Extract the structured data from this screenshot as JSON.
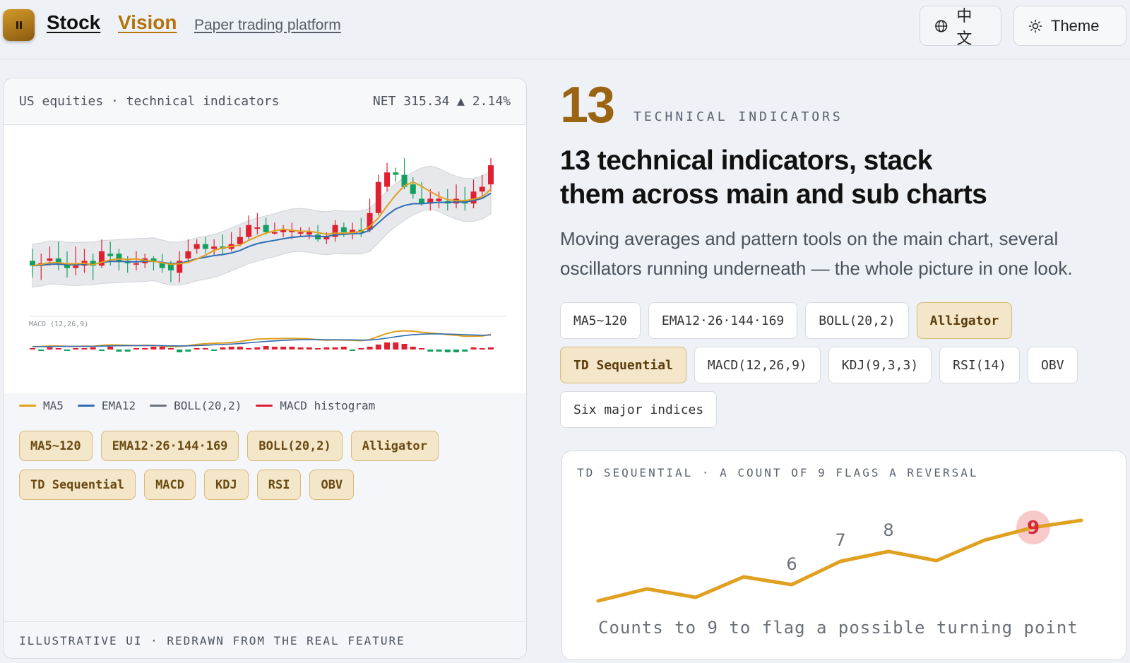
{
  "header": {
    "brand_part1": "Stock",
    "brand_part2": "Vision",
    "subtitle": "Paper trading platform",
    "lang_label": "中文",
    "theme_label": "Theme",
    "accent_color": "#b5730f"
  },
  "left_card": {
    "market_label": "US equities · technical indicators",
    "net_label": "NET 315.34 ▲ 2.14%",
    "macd_label": "MACD (12,26,9)",
    "legend": [
      {
        "label": "MA5",
        "color": "#e0a020"
      },
      {
        "label": "EMA12",
        "color": "#2f6db3"
      },
      {
        "label": "BOLL(20,2)",
        "color": "#6b7480"
      },
      {
        "label": "MACD histogram",
        "color": "#e02030"
      }
    ],
    "tags": [
      "MA5~120",
      "EMA12·26·144·169",
      "BOLL(20,2)",
      "Alligator",
      "TD Sequential",
      "MACD",
      "KDJ",
      "RSI",
      "OBV"
    ],
    "footer": "ILLUSTRATIVE UI · REDRAWN FROM THE REAL FEATURE"
  },
  "right": {
    "big_number": "13",
    "big_label": "TECHNICAL INDICATORS",
    "headline_line1": "13 technical indicators, stack",
    "headline_line2": "them across main and sub charts",
    "desc_line1": "Moving averages and pattern tools on the main chart, several",
    "desc_line2": "oscillators running underneath — the whole picture in one look.",
    "chips": [
      {
        "label": "MA5~120",
        "active": false
      },
      {
        "label": "EMA12·26·144·169",
        "active": false
      },
      {
        "label": "BOLL(20,2)",
        "active": false
      },
      {
        "label": "Alligator",
        "active": true
      },
      {
        "label": "TD Sequential",
        "active": true
      },
      {
        "label": "MACD(12,26,9)",
        "active": false
      },
      {
        "label": "KDJ(9,3,3)",
        "active": false
      },
      {
        "label": "RSI(14)",
        "active": false
      },
      {
        "label": "OBV",
        "active": false
      },
      {
        "label": "Six major indices",
        "active": false
      }
    ]
  },
  "td_card": {
    "title": "TD SEQUENTIAL · A COUNT OF 9 FLAGS A REVERSAL",
    "caption": "Counts to 9 to flag a possible turning point",
    "counts": [
      "6",
      "7",
      "8",
      "9"
    ],
    "line_color": "#e0a020",
    "highlight_color": "#f7c9c9"
  },
  "candle_chart": {
    "up_color": "#e02030",
    "down_color": "#13a060",
    "candles": [
      [
        52,
        50,
        45,
        57
      ],
      [
        50,
        51,
        44,
        55
      ],
      [
        52,
        53,
        50,
        58
      ],
      [
        53,
        51,
        48,
        60
      ],
      [
        51,
        49,
        45,
        56
      ],
      [
        49,
        50,
        46,
        58
      ],
      [
        50,
        52,
        47,
        57
      ],
      [
        52,
        50,
        44,
        55
      ],
      [
        50,
        56,
        49,
        61
      ],
      [
        55,
        54,
        50,
        60
      ],
      [
        55,
        52,
        48,
        57
      ],
      [
        52,
        51,
        47,
        54
      ],
      [
        51,
        51,
        48,
        56
      ],
      [
        51,
        53,
        49,
        55
      ],
      [
        53,
        52,
        48,
        54
      ],
      [
        51,
        49,
        47,
        55
      ],
      [
        51,
        48,
        43,
        52
      ],
      [
        47,
        52,
        43,
        56
      ],
      [
        53,
        56,
        52,
        61
      ],
      [
        57,
        59,
        55,
        61
      ],
      [
        59,
        57,
        55,
        62
      ],
      [
        57,
        58,
        54,
        61
      ],
      [
        58,
        57,
        55,
        63
      ],
      [
        57,
        59,
        56,
        64
      ],
      [
        59,
        62,
        58,
        66
      ],
      [
        62,
        67,
        61,
        71
      ],
      [
        66,
        66,
        63,
        72
      ],
      [
        67,
        64,
        63,
        70
      ],
      [
        64,
        64,
        63,
        68
      ],
      [
        64,
        65,
        62,
        67
      ],
      [
        64,
        65,
        61,
        68
      ],
      [
        64,
        64,
        62,
        66
      ],
      [
        63,
        64,
        61,
        66
      ],
      [
        63,
        61,
        60,
        67
      ],
      [
        61,
        62,
        59,
        64
      ],
      [
        62,
        67,
        60,
        69
      ],
      [
        66,
        64,
        62,
        68
      ],
      [
        64,
        65,
        61,
        68
      ],
      [
        65,
        64,
        62,
        70
      ],
      [
        65,
        72,
        64,
        78
      ],
      [
        72,
        85,
        71,
        88
      ],
      [
        83,
        89,
        81,
        93
      ],
      [
        89,
        88,
        85,
        91
      ],
      [
        88,
        83,
        82,
        95
      ],
      [
        84,
        80,
        78,
        87
      ],
      [
        78,
        76,
        75,
        85
      ],
      [
        76,
        78,
        73,
        82
      ],
      [
        77,
        78,
        74,
        81
      ],
      [
        77,
        76,
        73,
        82
      ],
      [
        76,
        78,
        74,
        84
      ],
      [
        77,
        76,
        73,
        83
      ],
      [
        76,
        81,
        74,
        86
      ],
      [
        81,
        83,
        79,
        88
      ],
      [
        84,
        92,
        81,
        95
      ]
    ],
    "macd_hist": [
      0.2,
      -0.1,
      0.3,
      0.2,
      -0.2,
      0.2,
      0.2,
      0.3,
      -0.2,
      0.4,
      -0.3,
      -0.3,
      0.2,
      0.2,
      0.4,
      0.4,
      0.2,
      -0.4,
      -0.3,
      0.2,
      0.2,
      -0.2,
      0.3,
      0.4,
      0.4,
      0.2,
      0.3,
      0.5,
      0.4,
      0.4,
      0.4,
      0.3,
      0.3,
      0.2,
      0.3,
      0.3,
      0.4,
      -0.2,
      0.2,
      0.4,
      0.7,
      1.0,
      1.0,
      0.8,
      0.4,
      0.2,
      -0.3,
      -0.3,
      -0.4,
      -0.4,
      -0.3,
      0.3,
      0.2,
      0.3
    ]
  }
}
